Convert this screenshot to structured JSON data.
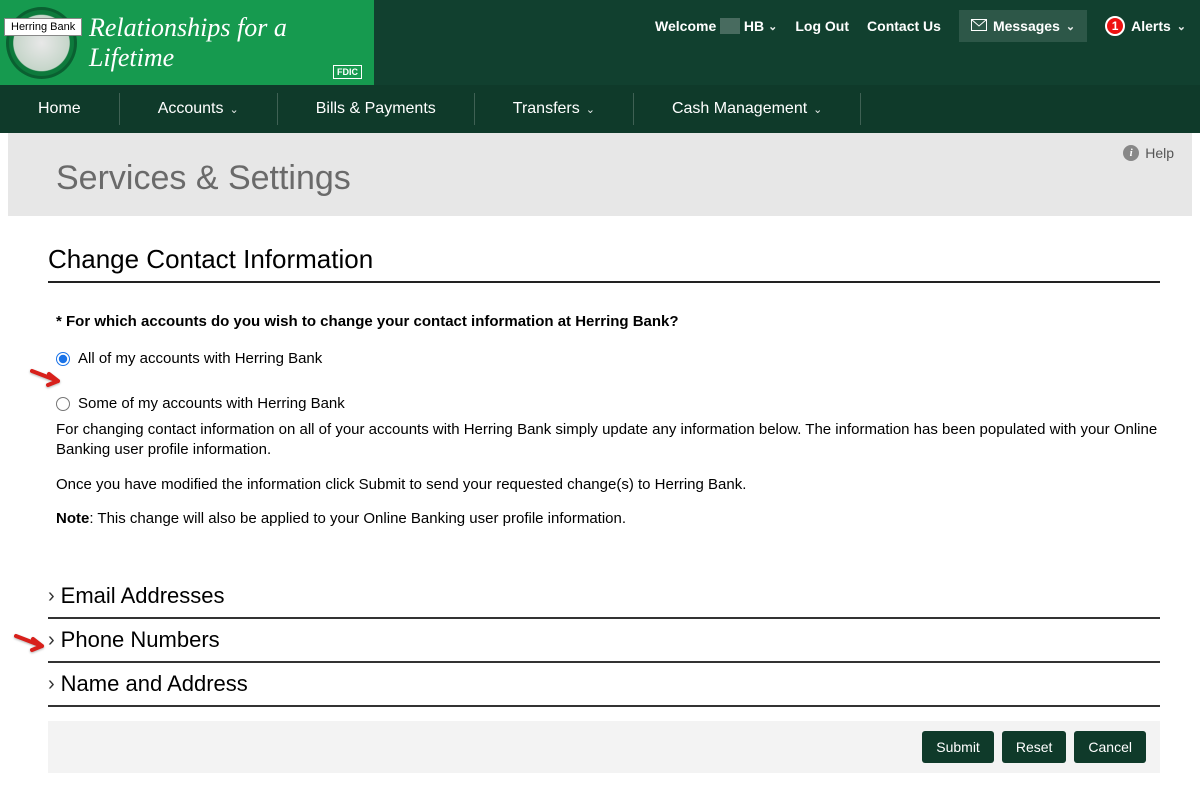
{
  "brand": {
    "tooltip": "Herring Bank",
    "tagline": "Relationships for a Lifetime",
    "fdic": "FDIC"
  },
  "topbar": {
    "welcome_prefix": "Welcome ",
    "user_initials": "HB",
    "logout": "Log Out",
    "contact": "Contact Us",
    "messages": "Messages",
    "alerts": "Alerts",
    "alert_count": "1"
  },
  "nav": {
    "home": "Home",
    "accounts": "Accounts",
    "bills": "Bills & Payments",
    "transfers": "Transfers",
    "cash": "Cash Management"
  },
  "help": "Help",
  "page_title": "Services & Settings",
  "section_title": "Change Contact Information",
  "question": "* For which accounts do you wish to change your contact information at Herring Bank?",
  "radio_all": "All of my accounts with Herring Bank",
  "radio_some": "Some of my accounts with Herring Bank",
  "para1": "For changing contact information on all of your accounts with Herring Bank simply update any information below. The information has been populated with your Online Banking user profile information.",
  "para2": "Once you have modified the information click Submit to send your requested change(s) to Herring Bank.",
  "note_label": "Note",
  "note_text": ": This change will also be applied to your Online Banking user profile information.",
  "acc": {
    "email": "Email Addresses",
    "phone": "Phone Numbers",
    "name": "Name and Address"
  },
  "buttons": {
    "submit": "Submit",
    "reset": "Reset",
    "cancel": "Cancel"
  }
}
